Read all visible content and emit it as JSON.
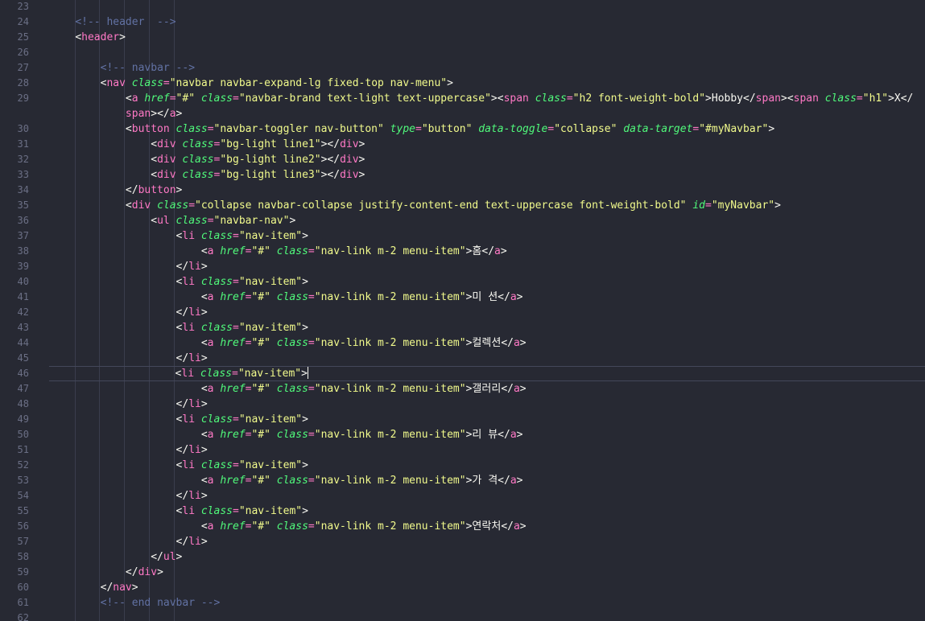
{
  "colors": {
    "background": "#272933",
    "line_number": "#6b6f85",
    "comment": "#6272a4",
    "tag": "#ff79c6",
    "attr": "#50fa7b",
    "string": "#f1fa8c",
    "text": "#f8f8f2",
    "indent_guide": "#3a3d4d",
    "active_line_border": "#44475a"
  },
  "editor": {
    "first_line": 24,
    "active_line": 46,
    "cursor_after": "<li class=\"nav-item\">",
    "lines": [
      {
        "n": "23",
        "text": ""
      },
      {
        "n": "24",
        "text": "    <!-- header  -->"
      },
      {
        "n": "25",
        "text": "    <header>"
      },
      {
        "n": "26",
        "text": ""
      },
      {
        "n": "27",
        "text": "        <!-- navbar -->"
      },
      {
        "n": "28",
        "text": "        <nav class=\"navbar navbar-expand-lg fixed-top nav-menu\">"
      },
      {
        "n": "29",
        "text": "            <a href=\"#\" class=\"navbar-brand text-light text-uppercase\"><span class=\"h2 font-weight-bold\">Hobby</span><span class=\"h1\">X</"
      },
      {
        "n": "",
        "text": "            span></a>"
      },
      {
        "n": "30",
        "text": "            <button class=\"navbar-toggler nav-button\" type=\"button\" data-toggle=\"collapse\" data-target=\"#myNavbar\">"
      },
      {
        "n": "31",
        "text": "                <div class=\"bg-light line1\"></div>"
      },
      {
        "n": "32",
        "text": "                <div class=\"bg-light line2\"></div>"
      },
      {
        "n": "33",
        "text": "                <div class=\"bg-light line3\"></div>"
      },
      {
        "n": "34",
        "text": "            </button>"
      },
      {
        "n": "35",
        "text": "            <div class=\"collapse navbar-collapse justify-content-end text-uppercase font-weight-bold\" id=\"myNavbar\">"
      },
      {
        "n": "36",
        "text": "                <ul class=\"navbar-nav\">"
      },
      {
        "n": "37",
        "text": "                    <li class=\"nav-item\">"
      },
      {
        "n": "38",
        "text": "                        <a href=\"#\" class=\"nav-link m-2 menu-item\">홈</a>"
      },
      {
        "n": "39",
        "text": "                    </li>"
      },
      {
        "n": "40",
        "text": "                    <li class=\"nav-item\">"
      },
      {
        "n": "41",
        "text": "                        <a href=\"#\" class=\"nav-link m-2 menu-item\">미 션</a>"
      },
      {
        "n": "42",
        "text": "                    </li>"
      },
      {
        "n": "43",
        "text": "                    <li class=\"nav-item\">"
      },
      {
        "n": "44",
        "text": "                        <a href=\"#\" class=\"nav-link m-2 menu-item\">컬렉션</a>"
      },
      {
        "n": "45",
        "text": "                    </li>"
      },
      {
        "n": "46",
        "text": "                    <li class=\"nav-item\">"
      },
      {
        "n": "47",
        "text": "                        <a href=\"#\" class=\"nav-link m-2 menu-item\">갤러리</a>"
      },
      {
        "n": "48",
        "text": "                    </li>"
      },
      {
        "n": "49",
        "text": "                    <li class=\"nav-item\">"
      },
      {
        "n": "50",
        "text": "                        <a href=\"#\" class=\"nav-link m-2 menu-item\">리 뷰</a>"
      },
      {
        "n": "51",
        "text": "                    </li>"
      },
      {
        "n": "52",
        "text": "                    <li class=\"nav-item\">"
      },
      {
        "n": "53",
        "text": "                        <a href=\"#\" class=\"nav-link m-2 menu-item\">가 격</a>"
      },
      {
        "n": "54",
        "text": "                    </li>"
      },
      {
        "n": "55",
        "text": "                    <li class=\"nav-item\">"
      },
      {
        "n": "56",
        "text": "                        <a href=\"#\" class=\"nav-link m-2 menu-item\">연락처</a>"
      },
      {
        "n": "57",
        "text": "                    </li>"
      },
      {
        "n": "58",
        "text": "                </ul>"
      },
      {
        "n": "59",
        "text": "            </div>"
      },
      {
        "n": "60",
        "text": "        </nav>"
      },
      {
        "n": "61",
        "text": "        <!-- end navbar -->"
      },
      {
        "n": "62",
        "text": ""
      }
    ]
  }
}
